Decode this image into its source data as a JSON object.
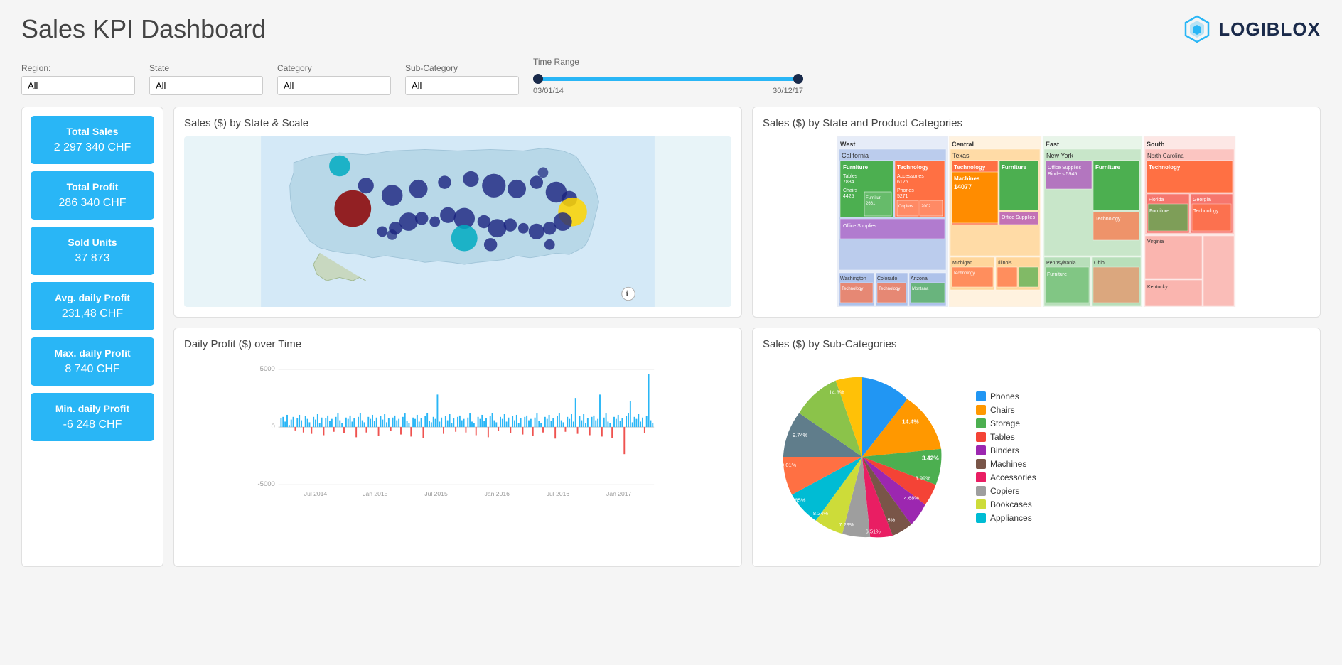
{
  "page": {
    "title": "Sales KPI Dashboard",
    "logo_text": "LOGIBLOX"
  },
  "filters": {
    "region_label": "Region:",
    "region_value": "All",
    "state_label": "State",
    "state_value": "All",
    "category_label": "Category",
    "category_value": "All",
    "subcategory_label": "Sub-Category",
    "subcategory_value": "All",
    "time_range_label": "Time Range",
    "time_start": "03/01/14",
    "time_end": "30/12/17"
  },
  "kpis": [
    {
      "title": "Total Sales",
      "value": "2 297 340 CHF"
    },
    {
      "title": "Total Profit",
      "value": "286 340 CHF"
    },
    {
      "title": "Sold Units",
      "value": "37 873"
    },
    {
      "title": "Avg. daily Profit",
      "value": "231,48 CHF"
    },
    {
      "title": "Max. daily Profit",
      "value": "8 740 CHF"
    },
    {
      "title": "Min. daily Profit",
      "value": "-6 248 CHF"
    }
  ],
  "charts": {
    "map_title": "Sales ($) by State & Scale",
    "treemap_title": "Sales ($) by State and Product Categories",
    "profit_title": "Daily Profit ($) over Time",
    "pie_title": "Sales ($) by Sub-Categories"
  },
  "pie_legend": [
    {
      "label": "Phones",
      "color": "#2196f3"
    },
    {
      "label": "Chairs",
      "color": "#ff9800"
    },
    {
      "label": "Storage",
      "color": "#4caf50"
    },
    {
      "label": "Tables",
      "color": "#f44336"
    },
    {
      "label": "Binders",
      "color": "#9c27b0"
    },
    {
      "label": "Machines",
      "color": "#795548"
    },
    {
      "label": "Accessories",
      "color": "#e91e63"
    },
    {
      "label": "Copiers",
      "color": "#9e9e9e"
    },
    {
      "label": "Bookcases",
      "color": "#cddc39"
    },
    {
      "label": "Appliances",
      "color": "#00bcd4"
    }
  ],
  "profit_axis": {
    "y_top": "5000",
    "y_zero": "0",
    "y_bottom": "-5000",
    "x_labels": [
      "Jul 2014",
      "Jan 2015",
      "Jul 2015",
      "Jan 2016",
      "Jul 2016",
      "Jan 2017"
    ]
  }
}
